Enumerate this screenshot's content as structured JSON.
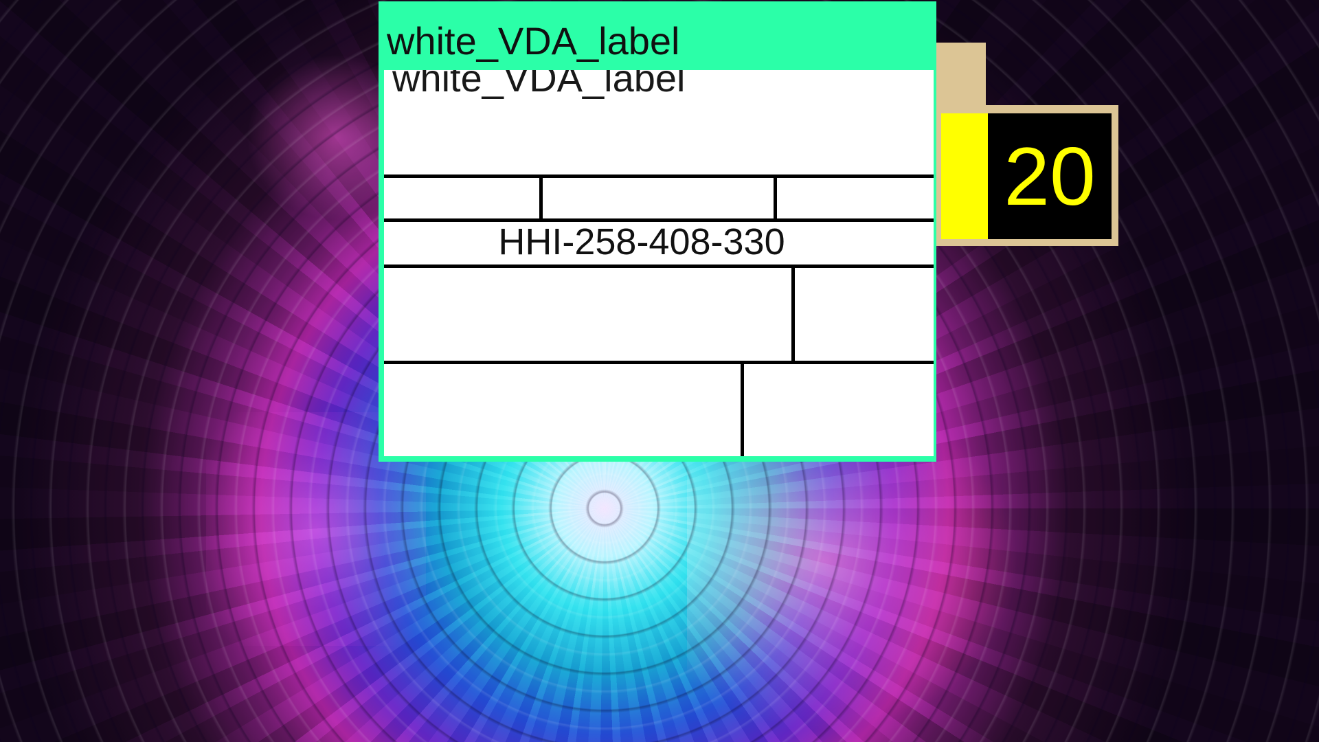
{
  "label_window": {
    "title": "white_VDA_label",
    "code": "HHI-258-408-330",
    "header_color": "#2bffa8",
    "body_color": "#ffffff"
  },
  "counter": {
    "value": "20",
    "accent_color": "#ffff00",
    "background_color": "#000000",
    "frame_color": "#dcc595"
  },
  "background": {
    "style": "abstract radial digital tunnel"
  }
}
